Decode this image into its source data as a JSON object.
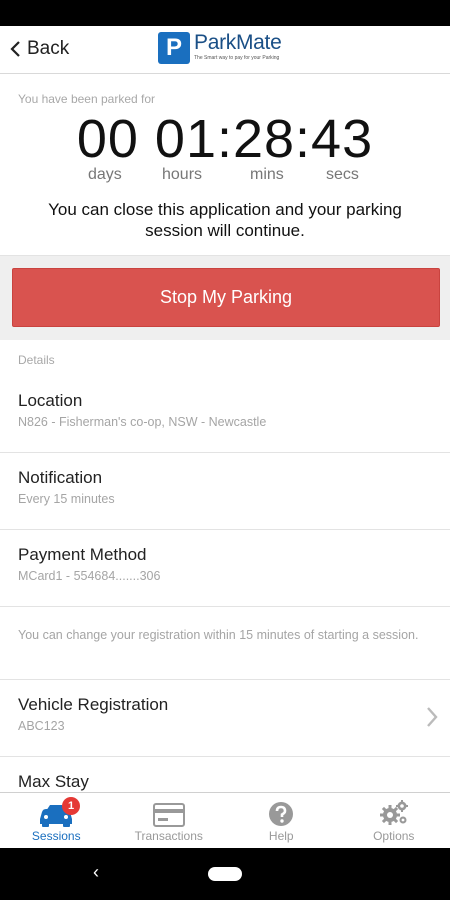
{
  "header": {
    "back_label": "Back",
    "logo_letter": "P",
    "logo_name": "ParkMate",
    "logo_tagline": "The Smart way to pay for your Parking"
  },
  "timer": {
    "label": "You have been parked for",
    "display": "00 01:28:43",
    "units": {
      "days": "days",
      "hours": "hours",
      "mins": "mins",
      "secs": "secs"
    },
    "note": "You can close this application and your parking session will continue."
  },
  "stop_button": {
    "label": "Stop My Parking"
  },
  "details": {
    "section_label": "Details",
    "location": {
      "title": "Location",
      "value": "N826 - Fisherman's co-op, NSW - Newcastle"
    },
    "notification": {
      "title": "Notification",
      "value": "Every 15 minutes"
    },
    "payment": {
      "title": "Payment Method",
      "value": "MCard1 - 554684.......306"
    },
    "registration_note": "You can change your registration within 15 minutes of starting a session.",
    "vehicle": {
      "title": "Vehicle Registration",
      "value": "ABC123"
    },
    "max_stay": {
      "title": "Max Stay"
    }
  },
  "bottom_nav": {
    "sessions": {
      "label": "Sessions",
      "badge": "1",
      "icon": "car-icon"
    },
    "transactions": {
      "label": "Transactions",
      "icon": "card-icon"
    },
    "help": {
      "label": "Help",
      "icon": "help-icon"
    },
    "options": {
      "label": "Options",
      "icon": "gears-icon"
    }
  },
  "colors": {
    "accent": "#1a6fbf",
    "stop_button": "#d9534f",
    "badge": "#e53935"
  }
}
